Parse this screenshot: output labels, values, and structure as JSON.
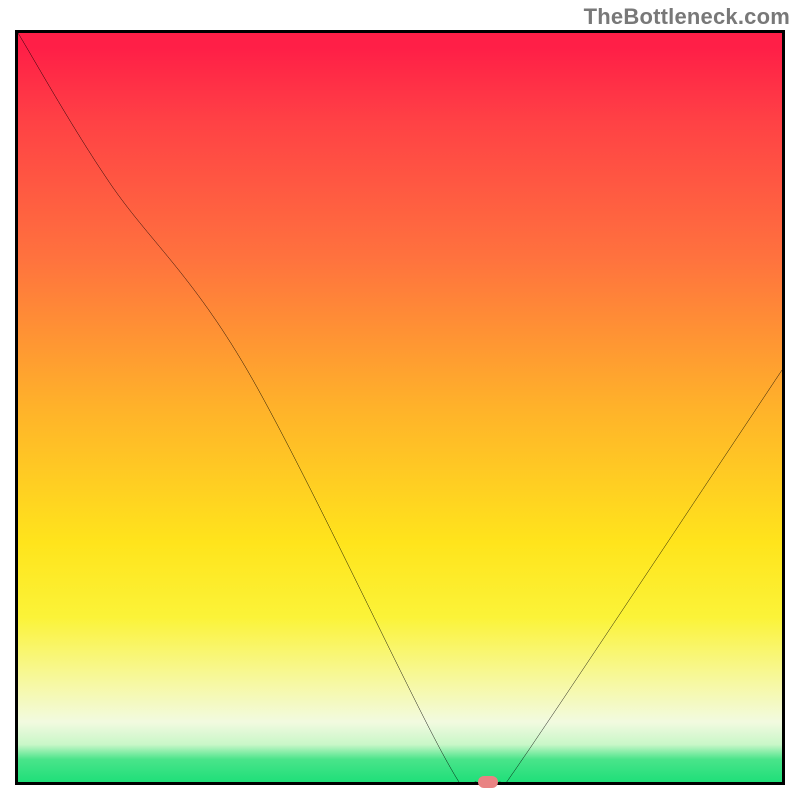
{
  "attribution": "TheBottleneck.com",
  "chart_data": {
    "type": "line",
    "title": "",
    "xlabel": "",
    "ylabel": "",
    "xlim": [
      0,
      100
    ],
    "ylim": [
      0,
      100
    ],
    "series": [
      {
        "name": "bottleneck-curve",
        "x": [
          0,
          12,
          30,
          56,
          60,
          63,
          66,
          100
        ],
        "values": [
          100,
          80,
          55,
          3,
          0,
          0,
          3,
          55
        ]
      }
    ],
    "marker": {
      "x": 61.5,
      "y": 0
    },
    "gradient_colors": {
      "top": "#ff1f47",
      "mid_upper": "#ff723e",
      "mid": "#ffe41c",
      "mid_lower": "#f7f899",
      "bottom": "#1fdf79"
    }
  }
}
